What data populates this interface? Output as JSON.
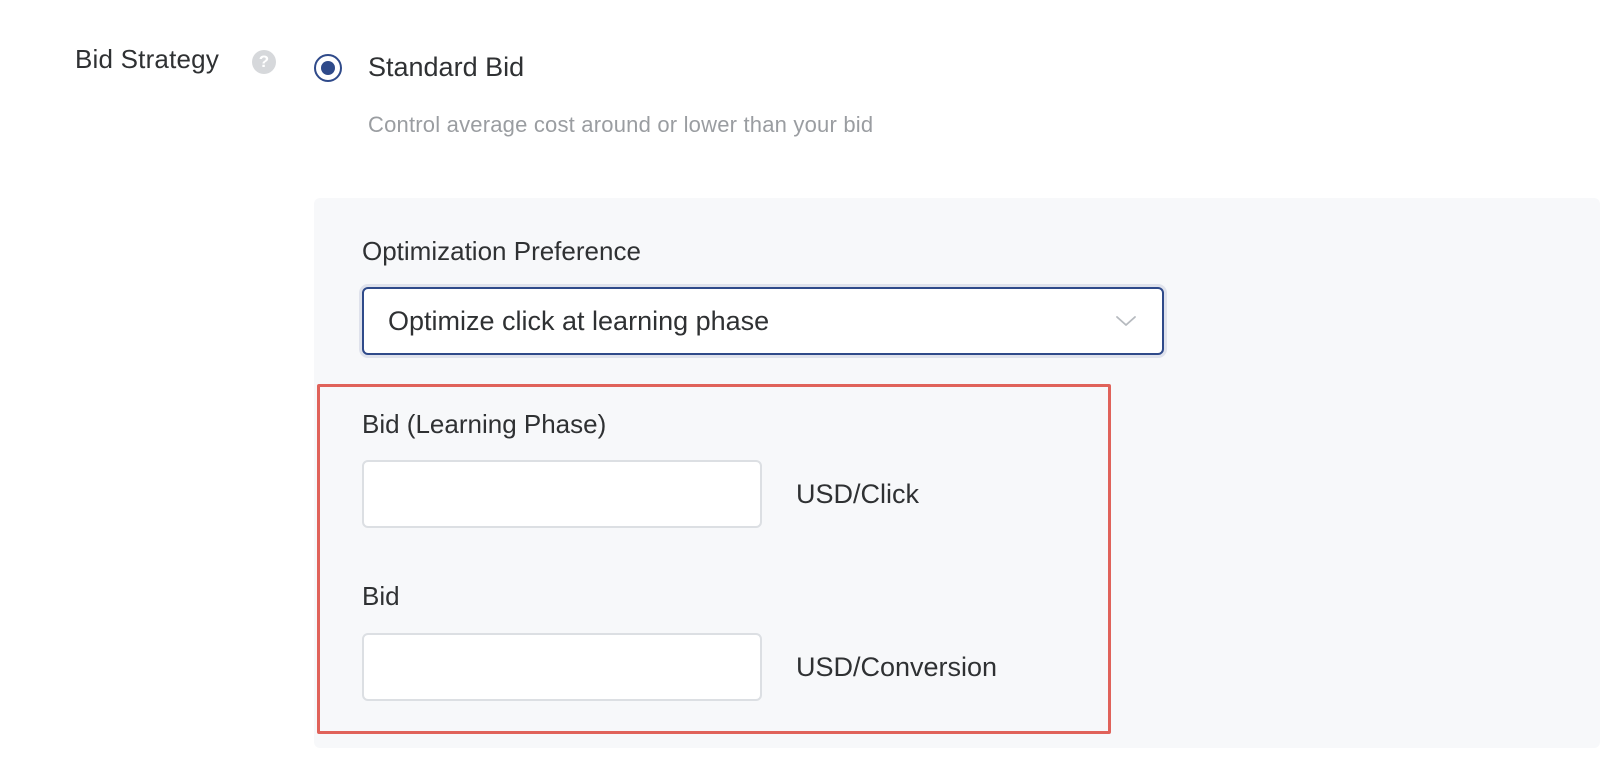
{
  "bid_strategy": {
    "label": "Bid Strategy",
    "help_glyph": "?",
    "option": {
      "label": "Standard Bid",
      "description": "Control average cost around or lower than your bid",
      "selected": true
    }
  },
  "optimization": {
    "label": "Optimization Preference",
    "selected_value": "Optimize click at learning phase"
  },
  "bid_learning": {
    "label": "Bid (Learning Phase)",
    "value": "",
    "unit": "USD/Click"
  },
  "bid": {
    "label": "Bid",
    "value": "",
    "unit": "USD/Conversion"
  },
  "colors": {
    "accent": "#2f4a8a",
    "highlight_border": "#e0625a",
    "panel_background": "#f7f8fa",
    "muted_text": "#9a9da1"
  }
}
